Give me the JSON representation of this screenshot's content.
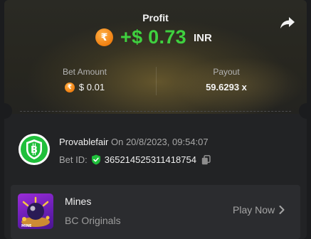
{
  "profit": {
    "label": "Profit",
    "coin_symbol": "₹",
    "amount": "+$ 0.73",
    "currency": "INR"
  },
  "bet_amount": {
    "label": "Bet Amount",
    "coin_symbol": "₹",
    "value": "$ 0.01"
  },
  "payout": {
    "label": "Payout",
    "value": "59.6293 x"
  },
  "provablefair": {
    "name": "Provablefair",
    "date": "On 20/8/2023, 09:54:07",
    "bet_id_label": "Bet ID:",
    "bet_id": "365214525311418754"
  },
  "game": {
    "name": "Mines",
    "subtitle": "BC Originals",
    "play_label": "Play Now",
    "thumb_label": "MINE"
  },
  "icons": {
    "share": "share-icon",
    "copy": "copy-icon",
    "verified": "verified-shield-icon",
    "chevron": "chevron-right-icon"
  },
  "colors": {
    "profit_green": "#3fd13f",
    "coin_orange": "#f07f10",
    "shield_green": "#1fbf3b"
  }
}
